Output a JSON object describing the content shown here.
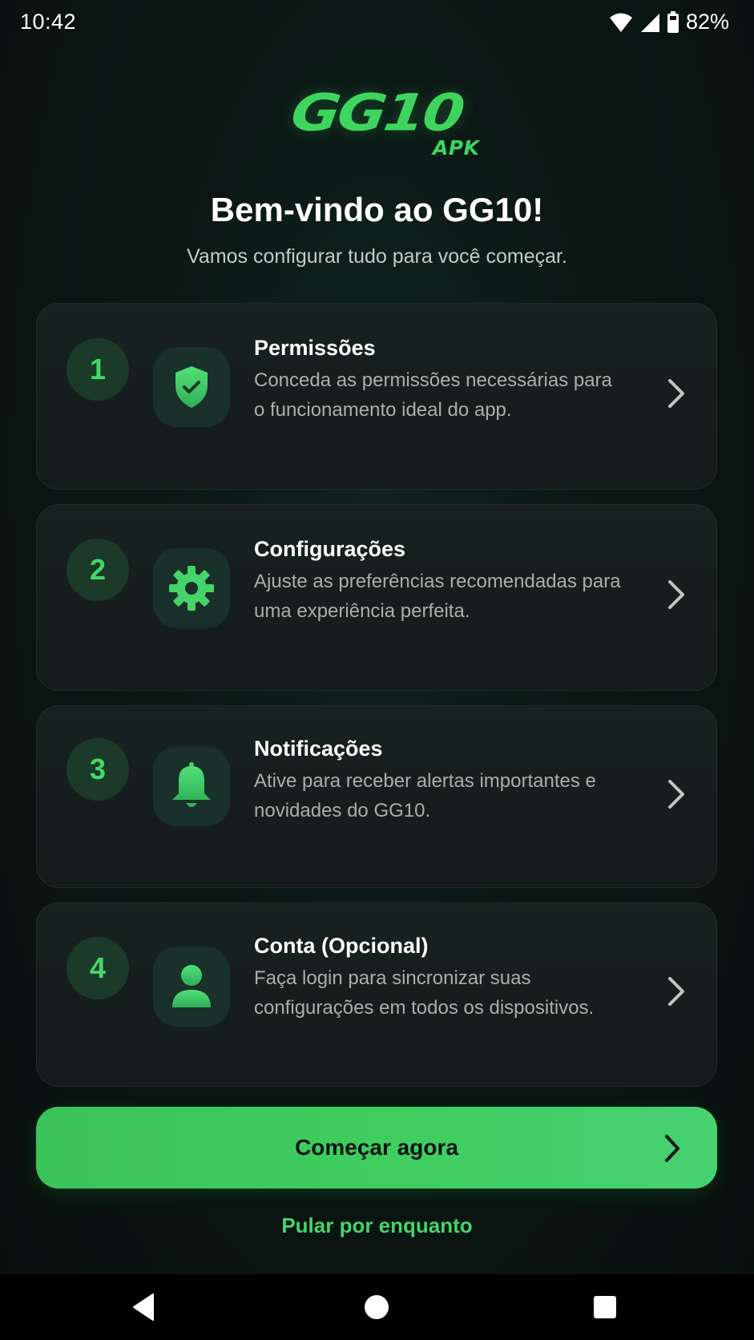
{
  "status_bar": {
    "time": "10:42",
    "battery": "82%",
    "icons": [
      "wifi-icon",
      "signal-icon",
      "battery-icon"
    ]
  },
  "logo": {
    "main": "GG10",
    "sub": "APK"
  },
  "welcome": {
    "title": "Bem-vindo ao GG10!",
    "subtitle": "Vamos configurar tudo para você começar."
  },
  "steps": [
    {
      "number": "1",
      "icon": "shield-check-icon",
      "title": "Permissões",
      "description": "Conceda as permissões necessárias para o funcionamento ideal do app."
    },
    {
      "number": "2",
      "icon": "gear-icon",
      "title": "Configurações",
      "description": "Ajuste as preferências recomendadas para uma experiência perfeita."
    },
    {
      "number": "3",
      "icon": "bell-icon",
      "title": "Notificações",
      "description": "Ative para receber alertas importantes e novidades do GG10."
    },
    {
      "number": "4",
      "icon": "user-icon",
      "title": "Conta (Opcional)",
      "description": "Faça login para sincronizar suas configurações em todos os dispositivos."
    }
  ],
  "primary_button": {
    "label": "Começar agora"
  },
  "skip_link": {
    "label": "Pular por enquanto"
  },
  "colors": {
    "accent": "#3ED55F",
    "background": "#0B1412",
    "card": "#161F1E",
    "muted_text": "#A8B0AD"
  },
  "nav_bar": {
    "icons": [
      "back-icon",
      "home-icon",
      "recents-icon"
    ]
  }
}
